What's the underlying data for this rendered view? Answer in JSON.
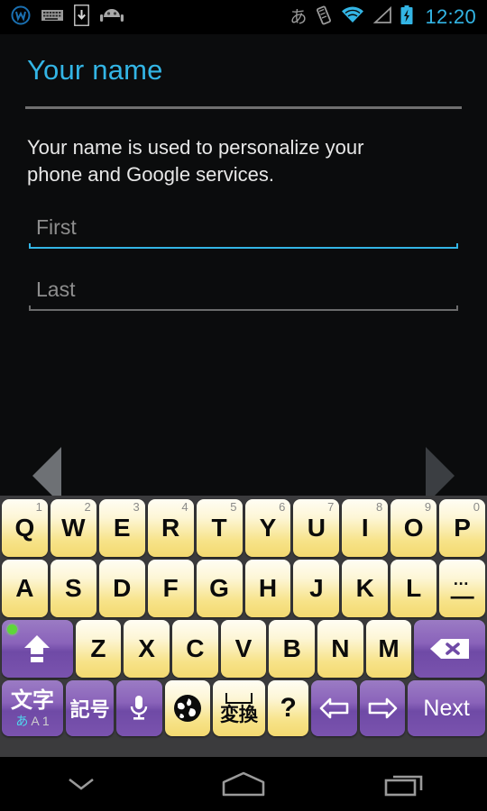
{
  "statusbar": {
    "time": "12:20",
    "ime_indicator": "あ",
    "left_icons": [
      "w-logo-icon",
      "keyboard-icon",
      "download-to-device-icon",
      "android-icon"
    ],
    "right_icons": [
      "ime-japanese-icon",
      "vibrate-icon",
      "wifi-icon",
      "cell-signal-icon",
      "battery-charging-icon"
    ],
    "accent_color": "#33b5e5"
  },
  "setup": {
    "title": "Your name",
    "description": "Your name is used to personalize your phone and Google services.",
    "fields": [
      {
        "name": "first",
        "placeholder": "First",
        "value": "",
        "focused": true
      },
      {
        "name": "last",
        "placeholder": "Last",
        "value": "",
        "focused": false
      }
    ],
    "nav": {
      "back": "back-arrow",
      "forward": "forward-arrow"
    }
  },
  "keyboard": {
    "row1": [
      {
        "label": "Q",
        "hint": "1"
      },
      {
        "label": "W",
        "hint": "2"
      },
      {
        "label": "E",
        "hint": "3"
      },
      {
        "label": "R",
        "hint": "4"
      },
      {
        "label": "T",
        "hint": "5"
      },
      {
        "label": "Y",
        "hint": "6"
      },
      {
        "label": "U",
        "hint": "7"
      },
      {
        "label": "I",
        "hint": "8"
      },
      {
        "label": "O",
        "hint": "9"
      },
      {
        "label": "P",
        "hint": "0"
      }
    ],
    "row2": [
      {
        "label": "A"
      },
      {
        "label": "S"
      },
      {
        "label": "D"
      },
      {
        "label": "F"
      },
      {
        "label": "G"
      },
      {
        "label": "H"
      },
      {
        "label": "J"
      },
      {
        "label": "K"
      },
      {
        "label": "L"
      }
    ],
    "row2_last": {
      "dots": "…",
      "dash": "—"
    },
    "row3": [
      {
        "label": "Z"
      },
      {
        "label": "X"
      },
      {
        "label": "C"
      },
      {
        "label": "V"
      },
      {
        "label": "B"
      },
      {
        "label": "N"
      },
      {
        "label": "M"
      }
    ],
    "shift": {
      "name": "shift-key",
      "caps_lock_on": true
    },
    "backspace": {
      "name": "backspace-key"
    },
    "row4": {
      "moji": {
        "main": "文字",
        "sub_kana": "あ",
        "sub_latin": "A 1"
      },
      "kigou": "記号",
      "mic": "mic-key",
      "globe": "globe-key",
      "henkan": "変換",
      "question": "?",
      "arrow_left": "◁",
      "arrow_right": "▷",
      "next": "Next"
    },
    "key_color": "#f7e389",
    "modifier_color": "#7a53ae"
  },
  "navbar": {
    "hide_keyboard": "hide-keyboard-chevron",
    "home": "home-button",
    "recents": "recents-button"
  }
}
